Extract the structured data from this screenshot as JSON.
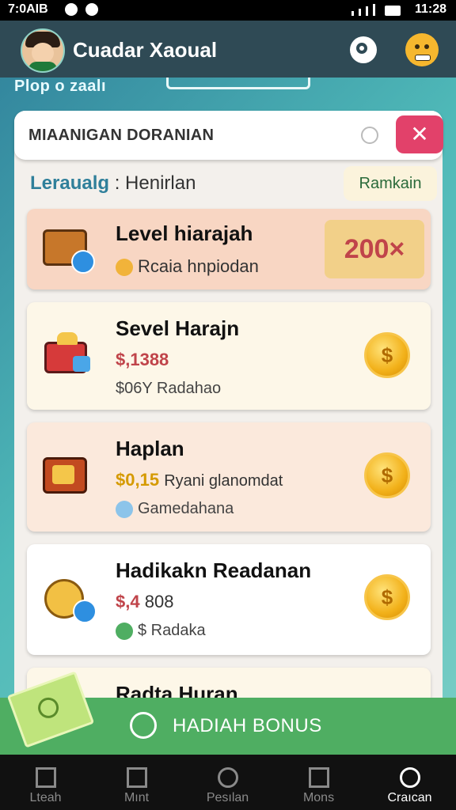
{
  "status_bar": {
    "time_left": "7:0AIB",
    "time_right": "11:28"
  },
  "app": {
    "title": "Cuadar Xaoual"
  },
  "subheader": {
    "text": "Plop o zaalı"
  },
  "search": {
    "text": "MIAANIGAN DORANIAN",
    "close_icon": "✕"
  },
  "section": {
    "label_accent": "Leraualg",
    "label_rest": " : Henirlan",
    "rank_button": "Ramkain"
  },
  "cards": [
    {
      "title": "Level hiarajah",
      "line2": "Rcaia hnpiodan",
      "reward": "200×",
      "icon": "treasure-chest-icon"
    },
    {
      "title": "Sevel Harajn",
      "price": "$,1388",
      "line3": "$06Y Radahao",
      "coin": "$",
      "icon": "gift-box-icon"
    },
    {
      "title": "Haplan",
      "price": "$0,15",
      "price_note": "Ryani glanomdat",
      "line3": "Gamedahana",
      "coin": "$",
      "icon": "tv-box-icon"
    },
    {
      "title": "Hadikakn Readanan",
      "price": "$,4",
      "price_note": "808",
      "line3": "$ Radaka",
      "coin": "$",
      "icon": "pizza-icon"
    },
    {
      "title": "Radta Huran"
    }
  ],
  "bonus": {
    "label": "HADIAH BONUS"
  },
  "nav": [
    {
      "label": "Lteah",
      "icon": "home-icon"
    },
    {
      "label": "Mınt",
      "icon": "square-icon"
    },
    {
      "label": "Pesılan",
      "icon": "circle-icon"
    },
    {
      "label": "Mons",
      "icon": "image-icon"
    },
    {
      "label": "Craıcan",
      "icon": "profile-icon"
    }
  ]
}
